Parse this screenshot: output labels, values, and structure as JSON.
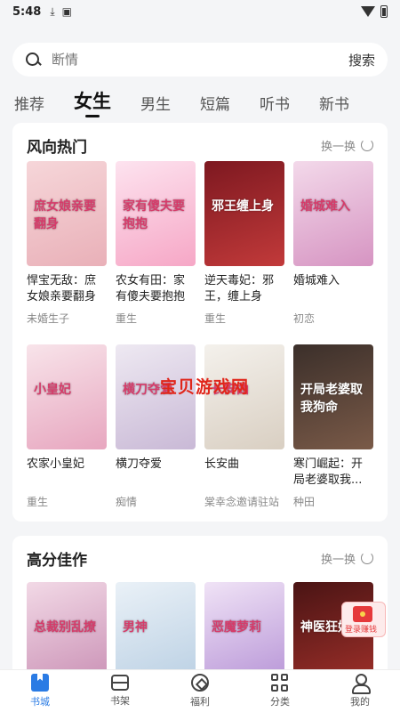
{
  "status_bar": {
    "time": "5:48",
    "icons": [
      "download-icon",
      "a-badge-icon"
    ]
  },
  "search": {
    "placeholder": "断情",
    "button": "搜索"
  },
  "tabs": [
    {
      "label": "推荐"
    },
    {
      "label": "女生",
      "active": true
    },
    {
      "label": "男生"
    },
    {
      "label": "短篇"
    },
    {
      "label": "听书"
    },
    {
      "label": "新书"
    }
  ],
  "section1": {
    "title": "风向热门",
    "refresh": "换一换",
    "books": [
      {
        "title": "悍宝无敌：庶女娘亲要翻身",
        "tag": "未婚生子",
        "cover_text": "庶女娘亲要翻身",
        "cover_colors": [
          "#f6d6d9",
          "#e9b0b8"
        ]
      },
      {
        "title": "农女有田：家有傻夫要抱抱",
        "tag": "重生",
        "cover_text": "家有傻夫要抱抱",
        "cover_colors": [
          "#fde3ef",
          "#f6a7c6"
        ]
      },
      {
        "title": "逆天毒妃：邪王，缠上身",
        "tag": "重生",
        "cover_text": "邪王缠上身",
        "cover_colors": [
          "#7d1820",
          "#c23a3a"
        ]
      },
      {
        "title": "婚城难入",
        "tag": "初恋",
        "cover_text": "婚城难入",
        "cover_colors": [
          "#f3d9ea",
          "#d694c2"
        ]
      },
      {
        "title": "农家小皇妃",
        "tag": "重生",
        "cover_text": "小皇妃",
        "cover_colors": [
          "#f8e4ea",
          "#e7a6bf"
        ]
      },
      {
        "title": "横刀夺爱",
        "tag": "痴情",
        "cover_text": "横刀夺爱",
        "cover_colors": [
          "#eee9f2",
          "#c9b9d6"
        ]
      },
      {
        "title": "长安曲",
        "tag": "棠幸念邀请驻站",
        "cover_text": "长安曲",
        "cover_colors": [
          "#f4f1ec",
          "#d9cfc2"
        ]
      },
      {
        "title": "寒门崛起：开局老婆取我...",
        "tag": "种田",
        "cover_text": "开局老婆取我狗命",
        "cover_colors": [
          "#3b2f2a",
          "#7a5a48"
        ]
      }
    ]
  },
  "watermark": "宝贝游戏网",
  "section2": {
    "title": "高分佳作",
    "refresh": "换一换",
    "books": [
      {
        "cover_text": "总裁别乱撩",
        "cover_colors": [
          "#f2d9e6",
          "#c98fb4"
        ]
      },
      {
        "cover_text": "男神",
        "cover_colors": [
          "#eaf1f7",
          "#b9cfe3"
        ]
      },
      {
        "cover_text": "恶魔萝莉",
        "cover_colors": [
          "#f0e3f6",
          "#b693d6"
        ]
      },
      {
        "cover_text": "神医狂妃",
        "cover_colors": [
          "#4a1414",
          "#a0302a"
        ]
      }
    ]
  },
  "float_button": {
    "label": "登录赚钱"
  },
  "bottom_nav": [
    {
      "label": "书城",
      "active": true
    },
    {
      "label": "书架"
    },
    {
      "label": "福利"
    },
    {
      "label": "分类"
    },
    {
      "label": "我的"
    }
  ]
}
